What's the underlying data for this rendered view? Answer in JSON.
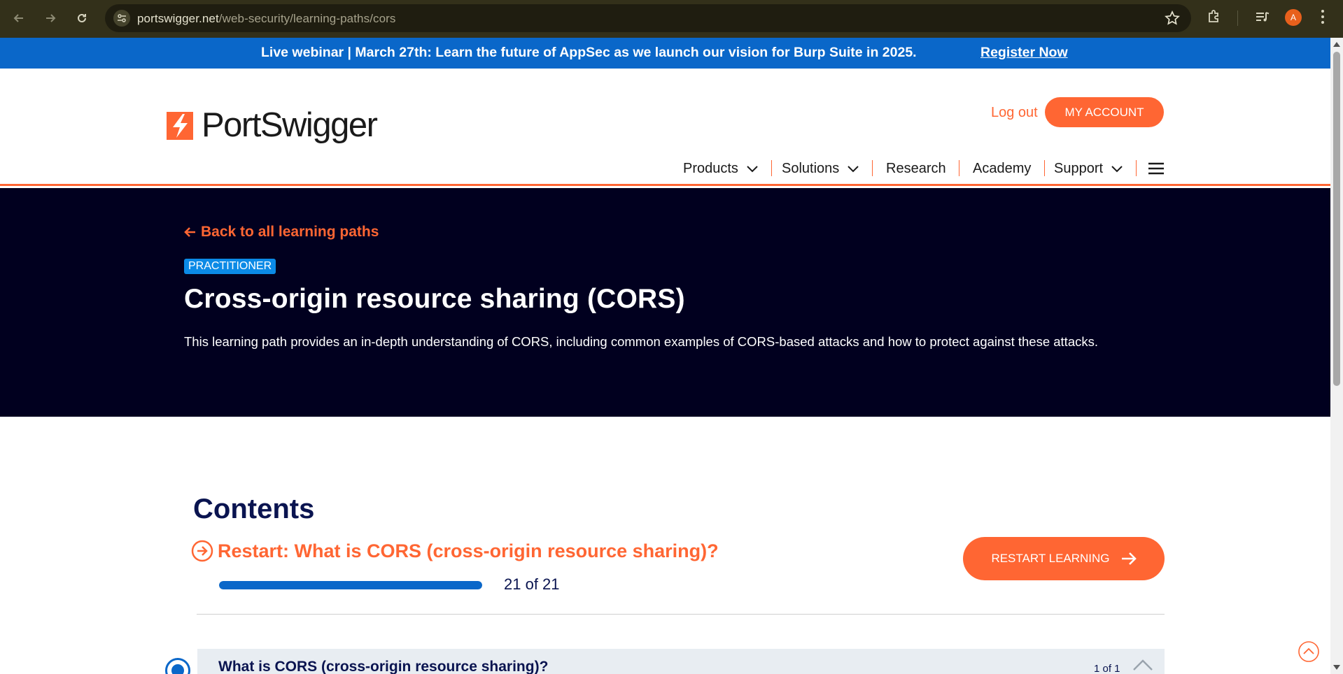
{
  "browser": {
    "url_host": "portswigger.net",
    "url_path": "/web-security/learning-paths/cors",
    "avatar_letter": "A"
  },
  "banner": {
    "message": "Live webinar | March 27th: Learn the future of AppSec as we launch our vision for Burp Suite in 2025.",
    "cta": "Register Now"
  },
  "header": {
    "logo_text": "PortSwigger",
    "logout": "Log out",
    "my_account": "MY ACCOUNT",
    "nav": {
      "products": "Products",
      "solutions": "Solutions",
      "research": "Research",
      "academy": "Academy",
      "support": "Support"
    }
  },
  "hero": {
    "back_link": "Back to all learning paths",
    "badge": "PRACTITIONER",
    "title": "Cross-origin resource sharing (CORS)",
    "description": "This learning path provides an in-depth understanding of CORS, including common examples of CORS-based attacks and how to protect against these attacks."
  },
  "contents": {
    "heading": "Contents",
    "restart_link": "Restart: What is CORS (cross-origin resource sharing)?",
    "progress_value": 21,
    "progress_total": 21,
    "progress_text": "21 of 21",
    "restart_button": "RESTART LEARNING",
    "sections": [
      {
        "title": "What is CORS (cross-origin resource sharing)?",
        "count": "1 of 1"
      }
    ]
  },
  "colors": {
    "accent": "#ff6633",
    "banner": "#0a67c9",
    "hero_bg": "#01001f",
    "heading": "#0a1450",
    "badge": "#0b8ae6"
  }
}
